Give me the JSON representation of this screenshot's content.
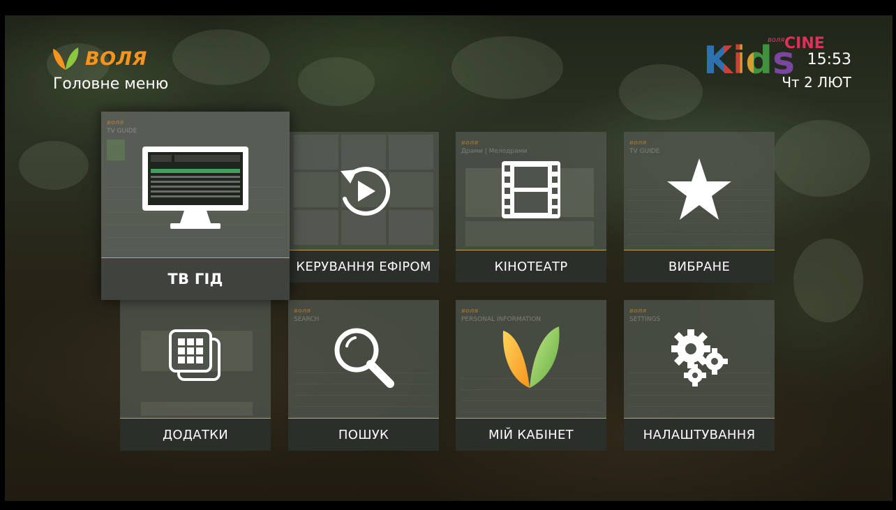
{
  "header": {
    "brand": "ВОЛЯ",
    "title": "Головне меню"
  },
  "channel": {
    "kids": "Kids",
    "cine": "CINE",
    "volya": "воля"
  },
  "clock": {
    "time": "15:53",
    "date": "Чт 2 ЛЮТ"
  },
  "colors": {
    "accent": "#f7941d",
    "divider": "#c8a05a"
  },
  "tiles": [
    {
      "label": "ТВ ГІД",
      "icon": "monitor-icon",
      "focused": true
    },
    {
      "label": "КЕРУВАННЯ ЕФІРОМ",
      "icon": "replay-icon",
      "focused": false
    },
    {
      "label": "КІНОТЕАТР",
      "icon": "film-icon",
      "focused": false
    },
    {
      "label": "ВИБРАНЕ",
      "icon": "star-icon",
      "focused": false
    },
    {
      "label": "ДОДАТКИ",
      "icon": "apps-icon",
      "focused": false
    },
    {
      "label": "ПОШУК",
      "icon": "search-icon",
      "focused": false
    },
    {
      "label": "МІЙ КАБІНЕТ",
      "icon": "volya-logo-icon",
      "focused": false
    },
    {
      "label": "НАЛАШТУВАННЯ",
      "icon": "gears-icon",
      "focused": false
    }
  ]
}
